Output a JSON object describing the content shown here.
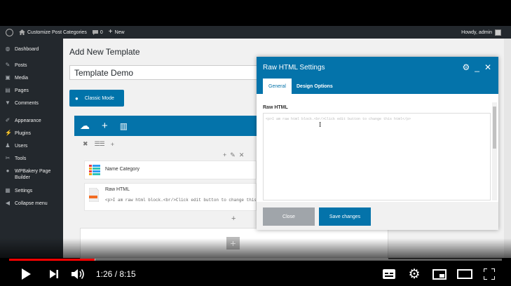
{
  "admin_bar": {
    "site_name": "Customize Post Categories",
    "comments_count": "0",
    "new_label": "New",
    "howdy": "Howdy, admin"
  },
  "sidebar": {
    "items": [
      {
        "label": "Dashboard",
        "icon": "dashboard-icon"
      },
      {
        "label": "Posts",
        "icon": "pin-icon"
      },
      {
        "label": "Media",
        "icon": "media-icon"
      },
      {
        "label": "Pages",
        "icon": "pages-icon"
      },
      {
        "label": "Comments",
        "icon": "comment-icon"
      },
      {
        "label": "Appearance",
        "icon": "brush-icon"
      },
      {
        "label": "Plugins",
        "icon": "plugin-icon"
      },
      {
        "label": "Users",
        "icon": "users-icon"
      },
      {
        "label": "Tools",
        "icon": "wrench-icon"
      },
      {
        "label": "WPBakery Page Builder",
        "icon": "wpbakery-icon"
      },
      {
        "label": "Settings",
        "icon": "settings-icon"
      },
      {
        "label": "Collapse menu",
        "icon": "collapse-icon"
      }
    ]
  },
  "editor": {
    "page_title": "Add New Template",
    "title_value": "Template Demo",
    "classic_mode_label": "Classic Mode",
    "elements": [
      {
        "label": "Name Category"
      },
      {
        "label": "Raw HTML",
        "preview": "<p>I am raw html block.<br/>Click edit button to change this html</p>"
      }
    ]
  },
  "modal": {
    "title": "Raw HTML Settings",
    "tab_general": "General",
    "tab_design": "Design Options",
    "field_label": "Raw HTML",
    "field_value": "<p>I am raw html block.<br/>Click edit button to change this html</p>",
    "close_label": "Close",
    "save_label": "Save changes"
  },
  "player": {
    "current_time": "1:26",
    "duration": "8:15",
    "time_display": "1:26 / 8:15",
    "progress_fraction": 0.174,
    "loaded_fraction": 0.175,
    "progress_color": "#ff0000"
  },
  "colors": {
    "wp_blue": "#0473aa",
    "admin_dark": "#23282d"
  }
}
